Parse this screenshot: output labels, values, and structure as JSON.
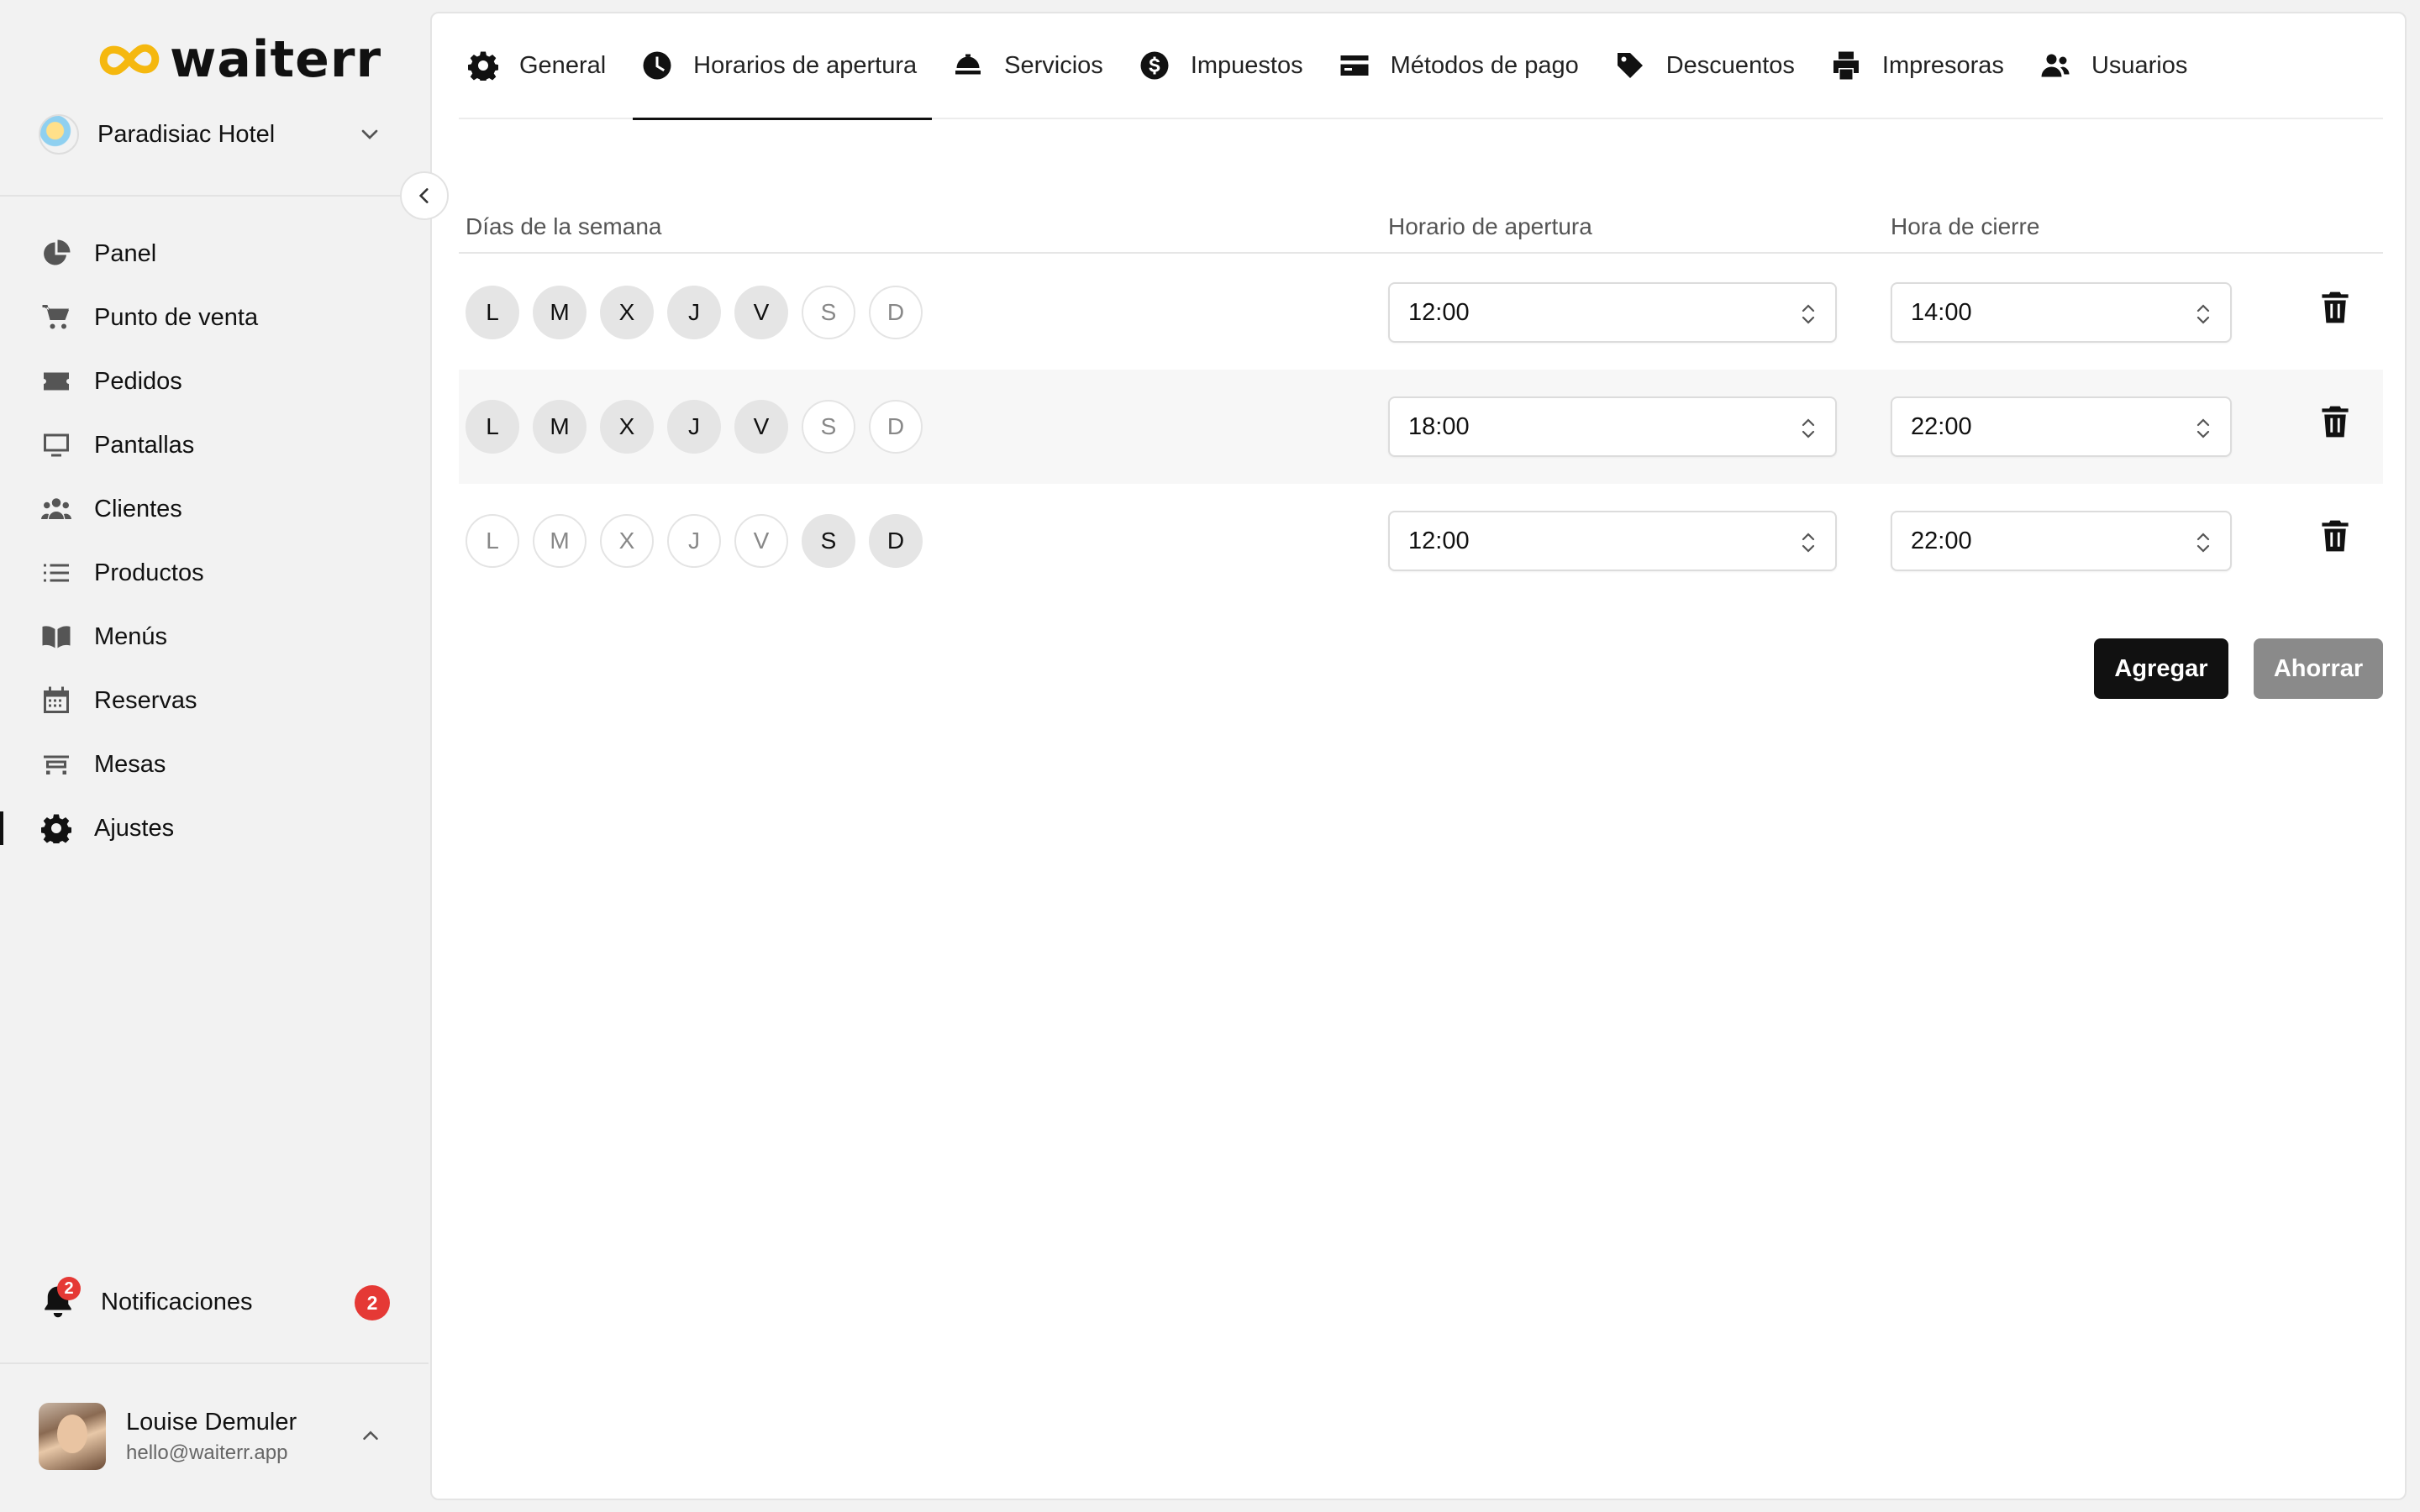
{
  "brand": {
    "name": "waiterr",
    "accent": "#f5b80f"
  },
  "hotel": {
    "name": "Paradisiac Hotel"
  },
  "nav": [
    {
      "label": "Panel",
      "icon": "pie-chart-icon"
    },
    {
      "label": "Punto de venta",
      "icon": "cart-icon"
    },
    {
      "label": "Pedidos",
      "icon": "ticket-icon"
    },
    {
      "label": "Pantallas",
      "icon": "monitor-icon"
    },
    {
      "label": "Clientes",
      "icon": "users-icon"
    },
    {
      "label": "Productos",
      "icon": "list-icon"
    },
    {
      "label": "Menús",
      "icon": "book-icon"
    },
    {
      "label": "Reservas",
      "icon": "calendar-icon"
    },
    {
      "label": "Mesas",
      "icon": "table-icon"
    },
    {
      "label": "Ajustes",
      "icon": "gear-icon",
      "active": true
    }
  ],
  "notifications": {
    "label": "Notificaciones",
    "count": "2"
  },
  "user": {
    "name": "Louise Demuler",
    "email": "hello@waiterr.app"
  },
  "tabs": [
    {
      "label": "General",
      "icon": "gear-icon"
    },
    {
      "label": "Horarios de apertura",
      "icon": "clock-icon",
      "active": true
    },
    {
      "label": "Servicios",
      "icon": "cloche-icon"
    },
    {
      "label": "Impuestos",
      "icon": "dollar-icon"
    },
    {
      "label": "Métodos de pago",
      "icon": "credit-card-icon"
    },
    {
      "label": "Descuentos",
      "icon": "tag-icon"
    },
    {
      "label": "Impresoras",
      "icon": "printer-icon"
    },
    {
      "label": "Usuarios",
      "icon": "user-group-icon"
    }
  ],
  "table": {
    "col_days": "Días de la semana",
    "col_open": "Horario de apertura",
    "col_close": "Hora de cierre"
  },
  "day_letters": [
    "L",
    "M",
    "X",
    "J",
    "V",
    "S",
    "D"
  ],
  "schedules": [
    {
      "days": [
        true,
        true,
        true,
        true,
        true,
        false,
        false
      ],
      "open": "12:00",
      "close": "14:00"
    },
    {
      "days": [
        true,
        true,
        true,
        true,
        true,
        false,
        false
      ],
      "open": "18:00",
      "close": "22:00"
    },
    {
      "days": [
        false,
        false,
        false,
        false,
        false,
        true,
        true
      ],
      "open": "12:00",
      "close": "22:00"
    }
  ],
  "actions": {
    "add": "Agregar",
    "save": "Ahorrar"
  }
}
